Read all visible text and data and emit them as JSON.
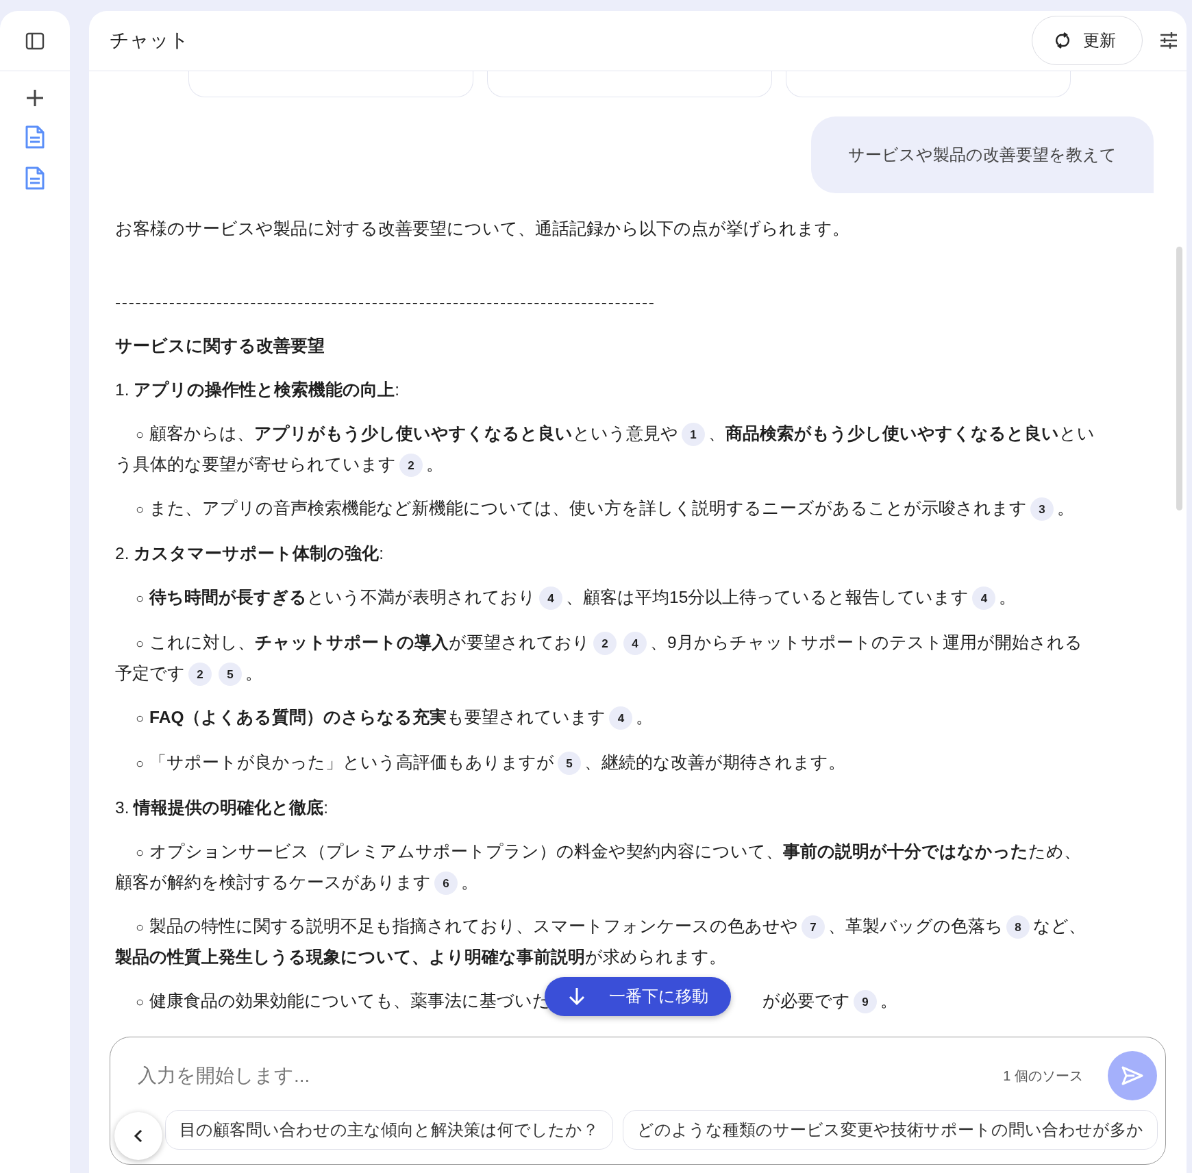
{
  "header": {
    "title": "チャット",
    "refresh_button": "更新"
  },
  "user_message": "サービスや製品の改善要望を教えて",
  "answer": [
    {
      "kind": "paragraph",
      "segments": [
        {
          "kind": "text",
          "text": "お客様のサービスや製品に対する改善要望について、通話記録から以下の点が挙げられます。"
        }
      ]
    },
    {
      "kind": "rule",
      "text": "--------------------------------------------------------------------------------"
    },
    {
      "kind": "heading",
      "text": "サービスに関する改善要望"
    },
    {
      "kind": "paragraph",
      "segments": [
        {
          "kind": "text",
          "text": "1. **アプリの操作性と検索機能の向上**:"
        }
      ]
    },
    {
      "kind": "bullet",
      "marker": "○",
      "segments": [
        {
          "kind": "text",
          "text": "顧客からは、**アプリがもう少し使いやすくなると良い**という意見や"
        },
        {
          "kind": "cite",
          "text": "1"
        },
        {
          "kind": "text",
          "text": "、**商品検索がもう少し使いやすくなると良い**という具体的な要望が寄せられています"
        },
        {
          "kind": "cite",
          "text": "2"
        },
        {
          "kind": "text",
          "text": "。"
        }
      ]
    },
    {
      "kind": "bullet",
      "marker": "○",
      "segments": [
        {
          "kind": "text",
          "text": "また、アプリの音声検索機能など新機能については、使い方を詳しく説明するニーズがあることが示唆されます"
        },
        {
          "kind": "cite",
          "text": "3"
        },
        {
          "kind": "text",
          "text": "。"
        }
      ]
    },
    {
      "kind": "paragraph",
      "segments": [
        {
          "kind": "text",
          "text": "2. **カスタマーサポート体制の強化**:"
        }
      ]
    },
    {
      "kind": "bullet",
      "marker": "○",
      "segments": [
        {
          "kind": "text",
          "text": "**待ち時間が長すぎる**という不満が表明されており"
        },
        {
          "kind": "cite",
          "text": "4"
        },
        {
          "kind": "text",
          "text": "、顧客は平均15分以上待っていると報告しています"
        },
        {
          "kind": "cite",
          "text": "4"
        },
        {
          "kind": "text",
          "text": "。"
        }
      ]
    },
    {
      "kind": "bullet",
      "marker": "○",
      "segments": [
        {
          "kind": "text",
          "text": "これに対し、**チャットサポートの導入**が要望されており"
        },
        {
          "kind": "cite",
          "text": "2"
        },
        {
          "kind": "cite",
          "text": "4"
        },
        {
          "kind": "text",
          "text": "、9月からチャットサポートのテスト運用が開始される予定です"
        },
        {
          "kind": "cite",
          "text": "2"
        },
        {
          "kind": "cite",
          "text": "5"
        },
        {
          "kind": "text",
          "text": "。"
        }
      ]
    },
    {
      "kind": "bullet",
      "marker": "○",
      "segments": [
        {
          "kind": "text",
          "text": "**FAQ（よくある質問）のさらなる充実**も要望されています"
        },
        {
          "kind": "cite",
          "text": "4"
        },
        {
          "kind": "text",
          "text": "。"
        }
      ]
    },
    {
      "kind": "bullet",
      "marker": "○",
      "segments": [
        {
          "kind": "text",
          "text": "「サポートが良かった」という高評価もありますが"
        },
        {
          "kind": "cite",
          "text": "5"
        },
        {
          "kind": "text",
          "text": "、継続的な改善が期待されます。"
        }
      ]
    },
    {
      "kind": "paragraph",
      "segments": [
        {
          "kind": "text",
          "text": "3. **情報提供の明確化と徹底**:"
        }
      ]
    },
    {
      "kind": "bullet",
      "marker": "○",
      "segments": [
        {
          "kind": "text",
          "text": "オプションサービス（プレミアムサポートプラン）の料金や契約内容について、**事前の説明が十分ではなかった**ため、顧客が解約を検討するケースがあります"
        },
        {
          "kind": "cite",
          "text": "6"
        },
        {
          "kind": "text",
          "text": "。"
        }
      ]
    },
    {
      "kind": "bullet",
      "marker": "○",
      "segments": [
        {
          "kind": "text",
          "text": "製品の特性に関する説明不足も指摘されており、スマートフォンケースの色あせや"
        },
        {
          "kind": "cite",
          "text": "7"
        },
        {
          "kind": "text",
          "text": "、革製バッグの色落ち"
        },
        {
          "kind": "cite",
          "text": "8"
        },
        {
          "kind": "text",
          "text": "など、**製品の性質上発生しうる現象について、より明確な事前説明**が求められます。"
        }
      ]
    },
    {
      "kind": "bullet",
      "marker": "○",
      "segments": [
        {
          "kind": "text",
          "text": "健康食品の効果効能についても、薬事法に基づいた"
        },
        {
          "kind": "covered"
        },
        {
          "kind": "text",
          "text": "が必要です"
        },
        {
          "kind": "cite",
          "text": "9"
        },
        {
          "kind": "text",
          "text": "。"
        }
      ]
    }
  ],
  "scroll_button": "一番下に移動",
  "composer": {
    "placeholder": "入力を開始します...",
    "source_count": "1 個のソース",
    "suggestions": [
      "目の顧客問い合わせの主な傾向と解決策は何でしたか？",
      "どのような種類のサービス変更や技術サポートの問い合わせが多か"
    ]
  }
}
